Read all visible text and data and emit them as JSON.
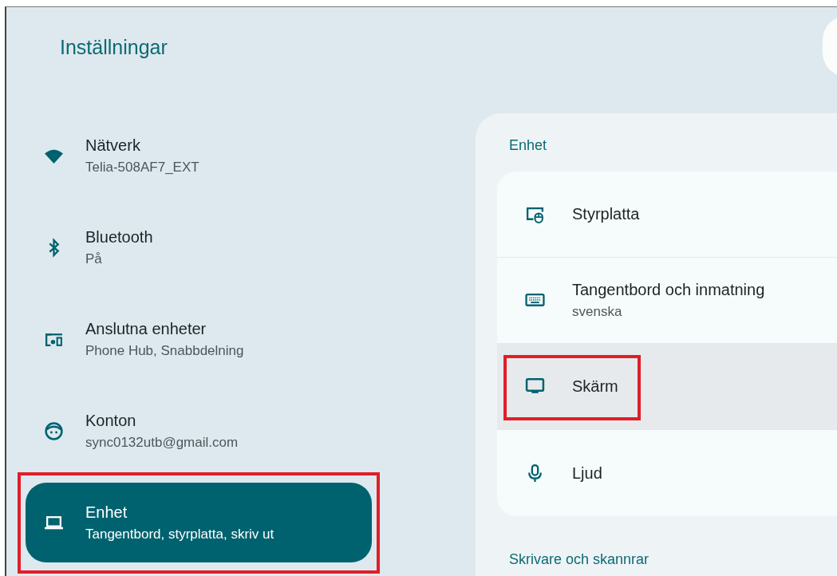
{
  "window": {
    "title": "Inställningar"
  },
  "sidebar": {
    "items": [
      {
        "kind": "wifi",
        "label": "Nätverk",
        "subtitle": "Telia-508AF7_EXT",
        "selected": false,
        "highlighted": false
      },
      {
        "kind": "bluetooth",
        "label": "Bluetooth",
        "subtitle": "På",
        "selected": false,
        "highlighted": false
      },
      {
        "kind": "devices",
        "label": "Anslutna enheter",
        "subtitle": "Phone Hub, Snabbdelning",
        "selected": false,
        "highlighted": false
      },
      {
        "kind": "account",
        "label": "Konton",
        "subtitle": "sync0132utb@gmail.com",
        "selected": false,
        "highlighted": false
      },
      {
        "kind": "laptop",
        "label": "Enhet",
        "subtitle": "Tangentbord, styrplatta, skriv ut",
        "selected": true,
        "highlighted": true
      }
    ]
  },
  "panel": {
    "heading": "Enhet",
    "items": [
      {
        "kind": "touchpad",
        "label": "Styrplatta",
        "selected": false,
        "highlighted": false
      },
      {
        "kind": "keyboard",
        "label": "Tangentbord och inmatning",
        "subtitle": "svenska",
        "selected": false,
        "highlighted": false
      },
      {
        "kind": "display",
        "label": "Skärm",
        "selected": true,
        "highlighted": true
      },
      {
        "kind": "mic",
        "label": "Ljud",
        "selected": false,
        "highlighted": false
      }
    ],
    "next_heading": "Skrivare och skannrar"
  }
}
